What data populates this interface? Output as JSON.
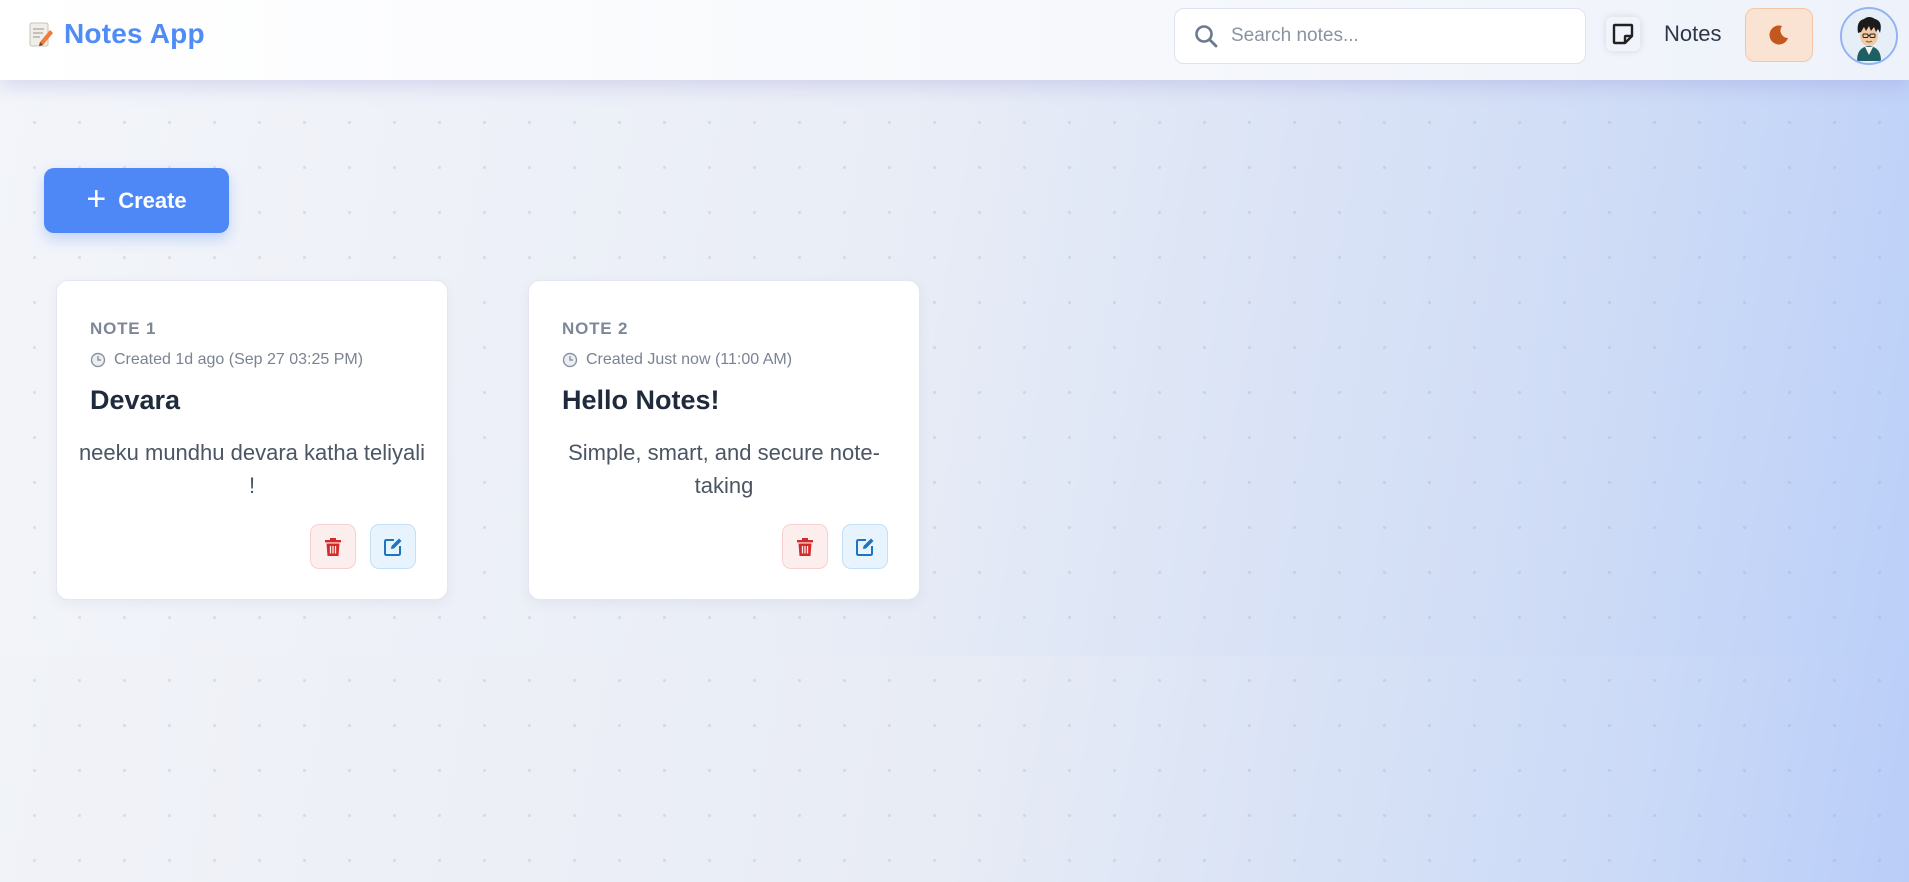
{
  "header": {
    "brand_title": "Notes App",
    "brand_icon": "memo-icon",
    "search": {
      "placeholder": "Search notes...",
      "value": ""
    },
    "nav_notes_label": "Notes",
    "theme_toggle_icon": "moon-icon",
    "avatar": "user-avatar"
  },
  "actions": {
    "create_label": "Create"
  },
  "notes": [
    {
      "number_label": "NOTE 1",
      "created": "Created 1d ago (Sep 27 03:25 PM)",
      "title": "Devara",
      "body": "neeku mundhu devara katha teliyali !"
    },
    {
      "number_label": "NOTE 2",
      "created": "Created Just now (11:00 AM)",
      "title": "Hello Notes!",
      "body": "Simple, smart, and secure note-taking"
    }
  ],
  "colors": {
    "brand": "#4f8cf7",
    "primary_button": "#4d88f6",
    "delete": "#d22b2b",
    "edit": "#1f73c2",
    "theme_toggle_bg": "#fbe3d3"
  }
}
